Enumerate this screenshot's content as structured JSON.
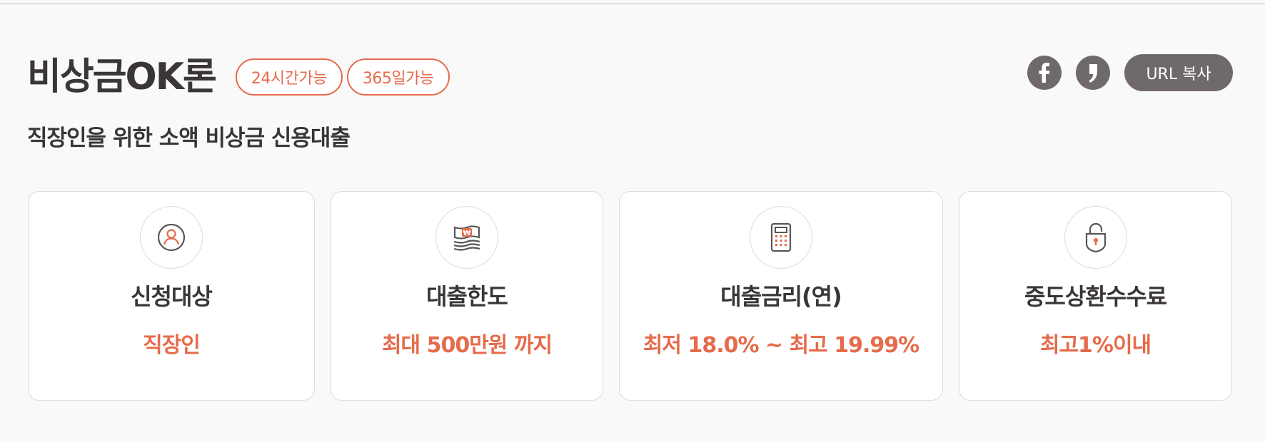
{
  "header": {
    "title": "비상금OK론",
    "badges": [
      "24시간가능",
      "365일가능"
    ],
    "subtitle": "직장인을 위한 소액 비상금 신용대출"
  },
  "share": {
    "facebook_icon": "facebook-icon",
    "kakao_icon": "kakaostory-icon",
    "url_copy_label": "URL 복사"
  },
  "cards": [
    {
      "icon": "person-icon",
      "label": "신청대상",
      "value": "직장인"
    },
    {
      "icon": "money-won-icon",
      "label": "대출한도",
      "value": "최대 500만원 까지"
    },
    {
      "icon": "calculator-icon",
      "label": "대출금리(연)",
      "value": "최저 18.0% ~ 최고 19.99%"
    },
    {
      "icon": "lock-icon",
      "label": "중도상환수수료",
      "value": "최고1%이내"
    }
  ],
  "colors": {
    "accent": "#e56b4b",
    "text": "#3a3636",
    "button_gray": "#6f6a69",
    "background": "#f9f9f9"
  }
}
